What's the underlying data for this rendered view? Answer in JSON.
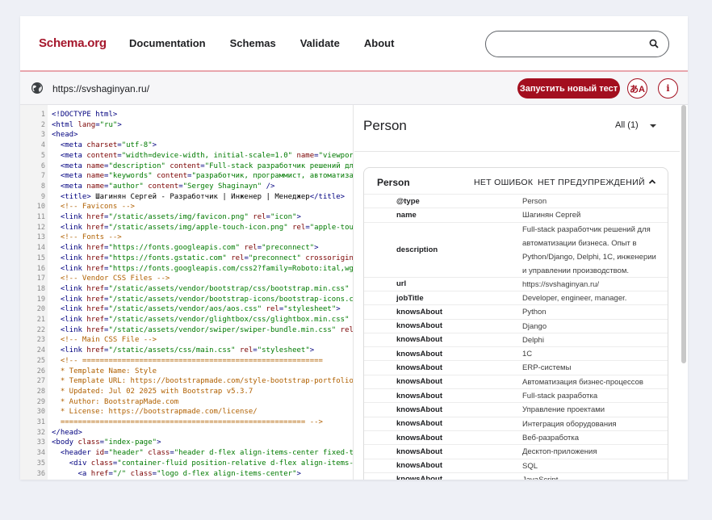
{
  "header": {
    "logo": "Schema.org",
    "nav": [
      "Documentation",
      "Schemas",
      "Validate",
      "About"
    ],
    "search_placeholder": ""
  },
  "urlbar": {
    "url": "https://svshaginyan.ru/",
    "run_button": "Запустить новый тест",
    "lang_button": "あA",
    "info_button": "i"
  },
  "code_lines": [
    {
      "n": "1",
      "segs": [
        [
          "t",
          "<!DOCTYPE html>"
        ]
      ]
    },
    {
      "n": "2",
      "segs": [
        [
          "t",
          "<html "
        ],
        [
          "a",
          "lang"
        ],
        [
          "t",
          "="
        ],
        [
          "s",
          "\"ru\""
        ],
        [
          "t",
          ">"
        ]
      ]
    },
    {
      "n": "3",
      "segs": [
        [
          "t",
          "<head>"
        ]
      ]
    },
    {
      "n": "4",
      "segs": [
        [
          "x",
          "  "
        ],
        [
          "t",
          "<meta "
        ],
        [
          "a",
          "charset"
        ],
        [
          "t",
          "="
        ],
        [
          "s",
          "\"utf-8\""
        ],
        [
          "t",
          ">"
        ]
      ]
    },
    {
      "n": "5",
      "segs": [
        [
          "x",
          "  "
        ],
        [
          "t",
          "<meta "
        ],
        [
          "a",
          "content"
        ],
        [
          "t",
          "="
        ],
        [
          "s",
          "\"width=device-width, initial-scale=1.0\""
        ],
        [
          "t",
          " "
        ],
        [
          "a",
          "name"
        ],
        [
          "t",
          "="
        ],
        [
          "s",
          "\"viewport\""
        ],
        [
          "t",
          ">"
        ]
      ]
    },
    {
      "n": "6",
      "segs": [
        [
          "x",
          "  "
        ],
        [
          "t",
          "<meta "
        ],
        [
          "a",
          "name"
        ],
        [
          "t",
          "="
        ],
        [
          "s",
          "\"description\""
        ],
        [
          "t",
          " "
        ],
        [
          "a",
          "content"
        ],
        [
          "t",
          "="
        ],
        [
          "s",
          "\"Full-stack разработчик решений для авто"
        ]
      ]
    },
    {
      "n": "7",
      "segs": [
        [
          "x",
          "  "
        ],
        [
          "t",
          "<meta "
        ],
        [
          "a",
          "name"
        ],
        [
          "t",
          "="
        ],
        [
          "s",
          "\"keywords\""
        ],
        [
          "t",
          " "
        ],
        [
          "a",
          "content"
        ],
        [
          "t",
          "="
        ],
        [
          "s",
          "\"разработчик, программист, автоматизация би"
        ]
      ]
    },
    {
      "n": "8",
      "segs": [
        [
          "x",
          "  "
        ],
        [
          "t",
          "<meta "
        ],
        [
          "a",
          "name"
        ],
        [
          "t",
          "="
        ],
        [
          "s",
          "\"author\""
        ],
        [
          "t",
          " "
        ],
        [
          "a",
          "content"
        ],
        [
          "t",
          "="
        ],
        [
          "s",
          "\"Sergey Shaginayn\""
        ],
        [
          "t",
          " />"
        ]
      ]
    },
    {
      "n": "9",
      "segs": [
        [
          "x",
          "  "
        ],
        [
          "t",
          "<title>"
        ],
        [
          "x",
          " Шагинян Сергей - Разработчик | Инженер | Менеджер"
        ],
        [
          "t",
          "</title>"
        ]
      ]
    },
    {
      "n": "10",
      "segs": [
        [
          "x",
          "  "
        ],
        [
          "c",
          "<!-- Favicons -->"
        ]
      ]
    },
    {
      "n": "11",
      "segs": [
        [
          "x",
          "  "
        ],
        [
          "t",
          "<link "
        ],
        [
          "a",
          "href"
        ],
        [
          "t",
          "="
        ],
        [
          "s",
          "\"/static/assets/img/favicon.png\""
        ],
        [
          "t",
          " "
        ],
        [
          "a",
          "rel"
        ],
        [
          "t",
          "="
        ],
        [
          "s",
          "\"icon\""
        ],
        [
          "t",
          ">"
        ]
      ]
    },
    {
      "n": "12",
      "segs": [
        [
          "x",
          "  "
        ],
        [
          "t",
          "<link "
        ],
        [
          "a",
          "href"
        ],
        [
          "t",
          "="
        ],
        [
          "s",
          "\"/static/assets/img/apple-touch-icon.png\""
        ],
        [
          "t",
          " "
        ],
        [
          "a",
          "rel"
        ],
        [
          "t",
          "="
        ],
        [
          "s",
          "\"apple-touch-ico"
        ]
      ]
    },
    {
      "n": "13",
      "segs": [
        [
          "x",
          "  "
        ],
        [
          "c",
          "<!-- Fonts -->"
        ]
      ]
    },
    {
      "n": "14",
      "segs": [
        [
          "x",
          "  "
        ],
        [
          "t",
          "<link "
        ],
        [
          "a",
          "href"
        ],
        [
          "t",
          "="
        ],
        [
          "s",
          "\"https://fonts.googleapis.com\""
        ],
        [
          "t",
          " "
        ],
        [
          "a",
          "rel"
        ],
        [
          "t",
          "="
        ],
        [
          "s",
          "\"preconnect\""
        ],
        [
          "t",
          ">"
        ]
      ]
    },
    {
      "n": "15",
      "segs": [
        [
          "x",
          "  "
        ],
        [
          "t",
          "<link "
        ],
        [
          "a",
          "href"
        ],
        [
          "t",
          "="
        ],
        [
          "s",
          "\"https://fonts.gstatic.com\""
        ],
        [
          "t",
          " "
        ],
        [
          "a",
          "rel"
        ],
        [
          "t",
          "="
        ],
        [
          "s",
          "\"preconnect\""
        ],
        [
          "t",
          " "
        ],
        [
          "a",
          "crossorigin"
        ],
        [
          "t",
          ">"
        ]
      ]
    },
    {
      "n": "16",
      "segs": [
        [
          "x",
          "  "
        ],
        [
          "t",
          "<link "
        ],
        [
          "a",
          "href"
        ],
        [
          "t",
          "="
        ],
        [
          "s",
          "\"https://fonts.googleapis.com/css2?family=Roboto:ital,wght@0,1"
        ]
      ]
    },
    {
      "n": "17",
      "segs": [
        [
          "x",
          "  "
        ],
        [
          "c",
          "<!-- Vendor CSS Files -->"
        ]
      ]
    },
    {
      "n": "18",
      "segs": [
        [
          "x",
          "  "
        ],
        [
          "t",
          "<link "
        ],
        [
          "a",
          "href"
        ],
        [
          "t",
          "="
        ],
        [
          "s",
          "\"/static/assets/vendor/bootstrap/css/bootstrap.min.css\""
        ],
        [
          "t",
          " "
        ],
        [
          "a",
          "rel"
        ],
        [
          "t",
          "="
        ],
        [
          "s",
          "\"s"
        ]
      ]
    },
    {
      "n": "19",
      "segs": [
        [
          "x",
          "  "
        ],
        [
          "t",
          "<link "
        ],
        [
          "a",
          "href"
        ],
        [
          "t",
          "="
        ],
        [
          "s",
          "\"/static/assets/vendor/bootstrap-icons/bootstrap-icons.css\""
        ],
        [
          "t",
          " "
        ],
        [
          "a",
          "rel"
        ]
      ]
    },
    {
      "n": "20",
      "segs": [
        [
          "x",
          "  "
        ],
        [
          "t",
          "<link "
        ],
        [
          "a",
          "href"
        ],
        [
          "t",
          "="
        ],
        [
          "s",
          "\"/static/assets/vendor/aos/aos.css\""
        ],
        [
          "t",
          " "
        ],
        [
          "a",
          "rel"
        ],
        [
          "t",
          "="
        ],
        [
          "s",
          "\"stylesheet\""
        ],
        [
          "t",
          ">"
        ]
      ]
    },
    {
      "n": "21",
      "segs": [
        [
          "x",
          "  "
        ],
        [
          "t",
          "<link "
        ],
        [
          "a",
          "href"
        ],
        [
          "t",
          "="
        ],
        [
          "s",
          "\"/static/assets/vendor/glightbox/css/glightbox.min.css\""
        ],
        [
          "t",
          " "
        ],
        [
          "a",
          "rel"
        ],
        [
          "t",
          "="
        ],
        [
          "s",
          "\"s"
        ]
      ]
    },
    {
      "n": "22",
      "segs": [
        [
          "x",
          "  "
        ],
        [
          "t",
          "<link "
        ],
        [
          "a",
          "href"
        ],
        [
          "t",
          "="
        ],
        [
          "s",
          "\"/static/assets/vendor/swiper/swiper-bundle.min.css\""
        ],
        [
          "t",
          " "
        ],
        [
          "a",
          "rel"
        ],
        [
          "t",
          "="
        ],
        [
          "s",
          "\"styl"
        ]
      ]
    },
    {
      "n": "23",
      "segs": [
        [
          "x",
          "  "
        ],
        [
          "c",
          "<!-- Main CSS File -->"
        ]
      ]
    },
    {
      "n": "24",
      "segs": [
        [
          "x",
          "  "
        ],
        [
          "t",
          "<link "
        ],
        [
          "a",
          "href"
        ],
        [
          "t",
          "="
        ],
        [
          "s",
          "\"/static/assets/css/main.css\""
        ],
        [
          "t",
          " "
        ],
        [
          "a",
          "rel"
        ],
        [
          "t",
          "="
        ],
        [
          "s",
          "\"stylesheet\""
        ],
        [
          "t",
          ">"
        ]
      ]
    },
    {
      "n": "25",
      "segs": [
        [
          "x",
          "  "
        ],
        [
          "c",
          "<!-- ======================================================="
        ]
      ]
    },
    {
      "n": "26",
      "segs": [
        [
          "c",
          "  * Template Name: Style"
        ]
      ]
    },
    {
      "n": "27",
      "segs": [
        [
          "c",
          "  * Template URL: https://bootstrapmade.com/style-bootstrap-portfolio-templ"
        ]
      ]
    },
    {
      "n": "28",
      "segs": [
        [
          "c",
          "  * Updated: Jul 02 2025 with Bootstrap v5.3.7"
        ]
      ]
    },
    {
      "n": "29",
      "segs": [
        [
          "c",
          "  * Author: BootstrapMade.com"
        ]
      ]
    },
    {
      "n": "30",
      "segs": [
        [
          "c",
          "  * License: https://bootstrapmade.com/license/"
        ]
      ]
    },
    {
      "n": "31",
      "segs": [
        [
          "c",
          "  ======================================================== -->"
        ]
      ]
    },
    {
      "n": "32",
      "segs": [
        [
          "t",
          "</head>"
        ]
      ]
    },
    {
      "n": "33",
      "segs": [
        [
          "t",
          "<body "
        ],
        [
          "a",
          "class"
        ],
        [
          "t",
          "="
        ],
        [
          "s",
          "\"index-page\""
        ],
        [
          "t",
          ">"
        ]
      ]
    },
    {
      "n": "34",
      "segs": [
        [
          "x",
          "  "
        ],
        [
          "t",
          "<header "
        ],
        [
          "a",
          "id"
        ],
        [
          "t",
          "="
        ],
        [
          "s",
          "\"header\""
        ],
        [
          "t",
          " "
        ],
        [
          "a",
          "class"
        ],
        [
          "t",
          "="
        ],
        [
          "s",
          "\"header d-flex align-items-center fixed-top\""
        ],
        [
          "t",
          ">"
        ]
      ]
    },
    {
      "n": "35",
      "segs": [
        [
          "x",
          "    "
        ],
        [
          "t",
          "<div "
        ],
        [
          "a",
          "class"
        ],
        [
          "t",
          "="
        ],
        [
          "s",
          "\"container-fluid position-relative d-flex align-items-center"
        ]
      ]
    },
    {
      "n": "36",
      "segs": [
        [
          "x",
          "      "
        ],
        [
          "t",
          "<a "
        ],
        [
          "a",
          "href"
        ],
        [
          "t",
          "="
        ],
        [
          "s",
          "\"/\""
        ],
        [
          "t",
          " "
        ],
        [
          "a",
          "class"
        ],
        [
          "t",
          "="
        ],
        [
          "s",
          "\"logo d-flex align-items-center\""
        ],
        [
          "t",
          ">"
        ]
      ]
    }
  ],
  "results": {
    "type_title": "Person",
    "filter": "All (1)",
    "card_title": "Person",
    "no_errors": "НЕТ ОШИБОК",
    "no_warnings": "НЕТ ПРЕДУПРЕЖДЕНИЙ",
    "rows": [
      {
        "key": "@type",
        "value": "Person"
      },
      {
        "key": "name",
        "value": "Шагинян Сергей"
      },
      {
        "key": "description",
        "value": "Full-stack разработчик решений для автоматизации бизнеса. Опыт в Python/Django, Delphi, 1С, инженерии и управлении производством."
      },
      {
        "key": "url",
        "value": "https://svshaginyan.ru/"
      },
      {
        "key": "jobTitle",
        "value": "Developer, engineer, manager."
      },
      {
        "key": "knowsAbout",
        "value": "Python"
      },
      {
        "key": "knowsAbout",
        "value": "Django"
      },
      {
        "key": "knowsAbout",
        "value": "Delphi"
      },
      {
        "key": "knowsAbout",
        "value": "1С"
      },
      {
        "key": "knowsAbout",
        "value": "ERP-системы"
      },
      {
        "key": "knowsAbout",
        "value": "Автоматизация бизнес-процессов"
      },
      {
        "key": "knowsAbout",
        "value": "Full-stack разработка"
      },
      {
        "key": "knowsAbout",
        "value": "Управление проектами"
      },
      {
        "key": "knowsAbout",
        "value": "Интеграция оборудования"
      },
      {
        "key": "knowsAbout",
        "value": "Веб-разработка"
      },
      {
        "key": "knowsAbout",
        "value": "Десктоп-приложения"
      },
      {
        "key": "knowsAbout",
        "value": "SQL"
      },
      {
        "key": "knowsAbout",
        "value": "JavaScript"
      }
    ]
  },
  "colors": {
    "brand": "#a5172c",
    "accent": "#a30f1f"
  }
}
